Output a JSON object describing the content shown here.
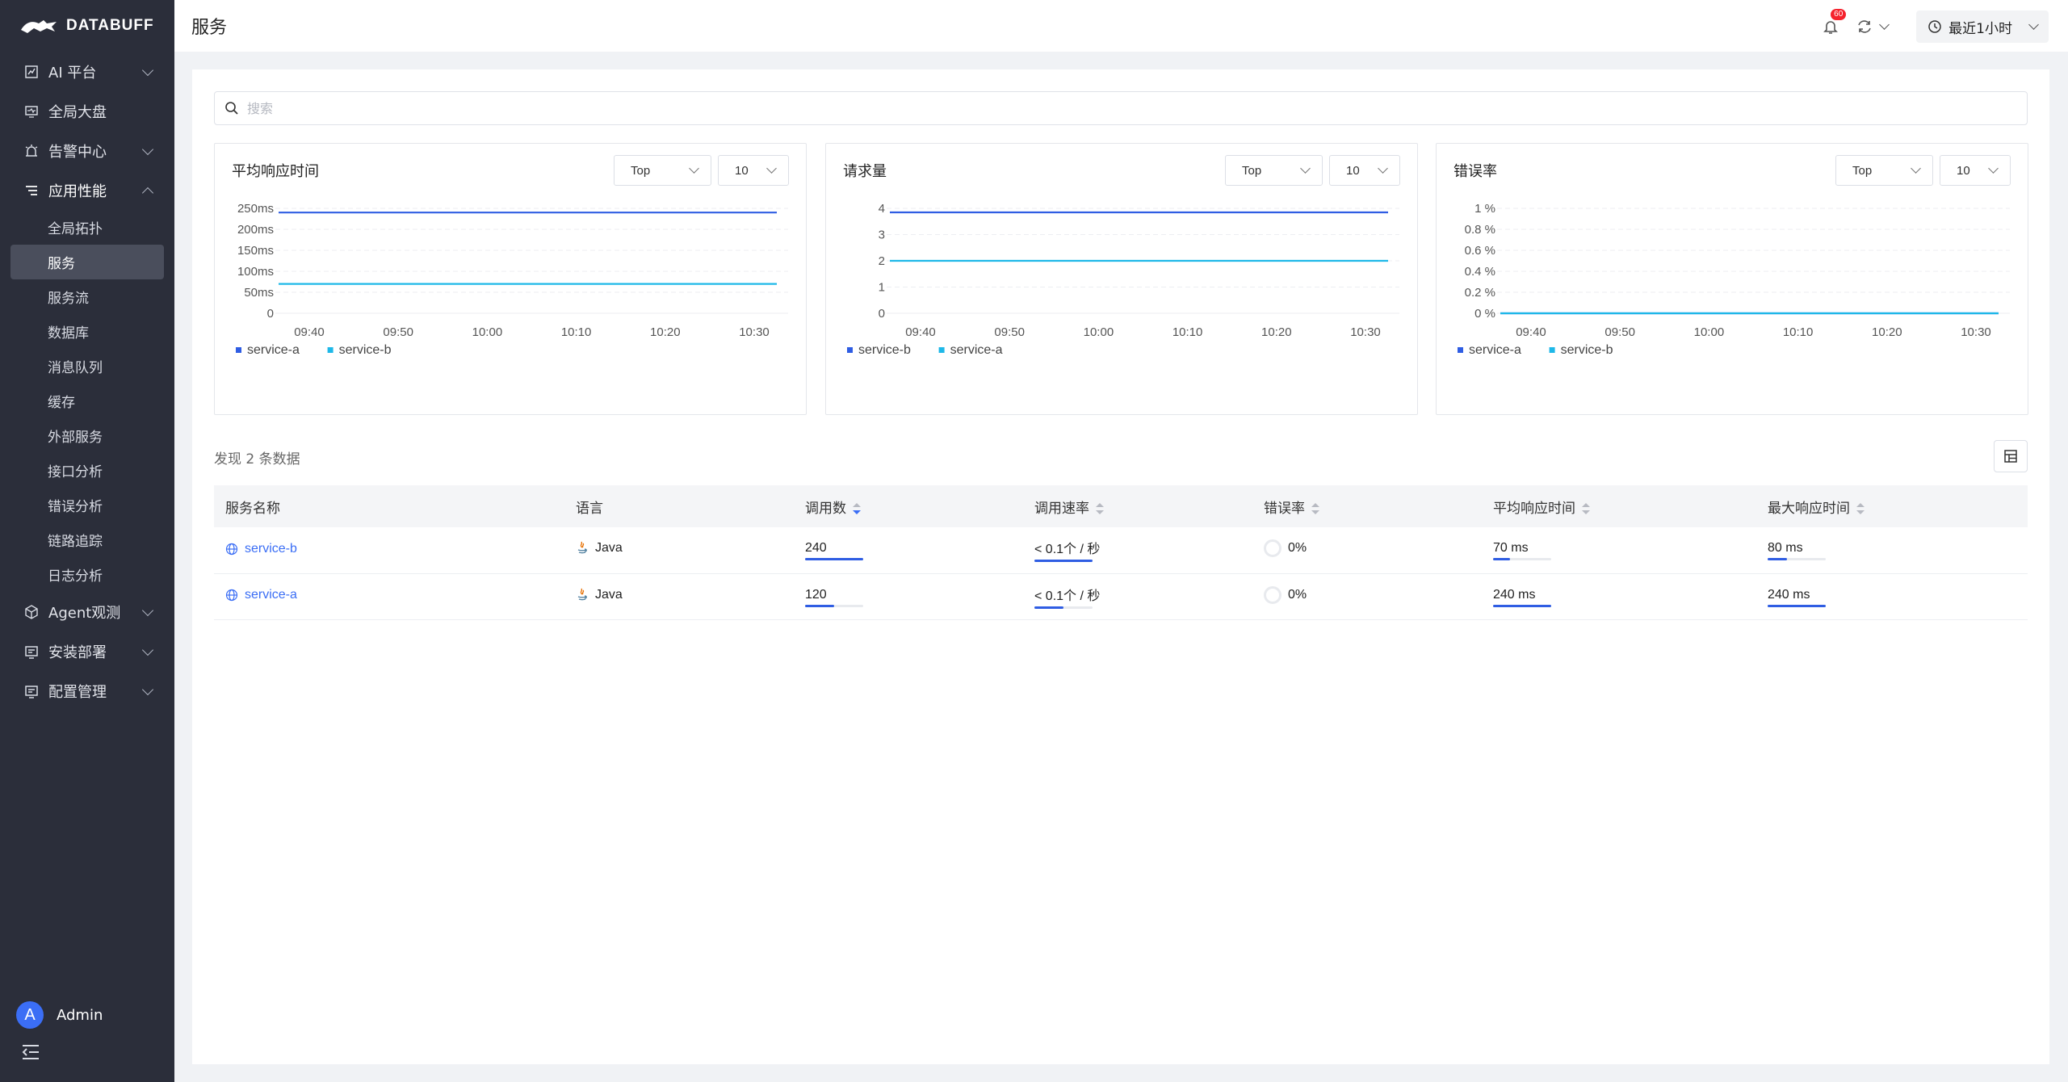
{
  "app": {
    "name": "DATABUFF"
  },
  "sidebar": {
    "items": [
      {
        "label": "AI 平台",
        "icon": "chart-icon",
        "expandable": true
      },
      {
        "label": "全局大盘",
        "icon": "monitor-icon",
        "expandable": false
      },
      {
        "label": "告警中心",
        "icon": "alarm-icon",
        "expandable": true
      },
      {
        "label": "应用性能",
        "icon": "filter-icon",
        "expandable": true,
        "expanded": true
      }
    ],
    "sub_items": [
      "全局拓扑",
      "服务",
      "服务流",
      "数据库",
      "消息队列",
      "缓存",
      "外部服务",
      "接口分析",
      "错误分析",
      "链路追踪",
      "日志分析"
    ],
    "active_sub": "服务",
    "bottom_items": [
      {
        "label": "Agent观测",
        "icon": "cube-icon"
      },
      {
        "label": "安装部署",
        "icon": "install-icon"
      },
      {
        "label": "配置管理",
        "icon": "config-icon"
      }
    ],
    "user": {
      "initial": "A",
      "name": "Admin"
    }
  },
  "header": {
    "title": "服务",
    "notification_count": "60",
    "time_range": "最近1小时"
  },
  "search": {
    "placeholder": "搜索"
  },
  "charts_ui": [
    {
      "title": "平均响应时间",
      "mode": "Top",
      "count": "10"
    },
    {
      "title": "请求量",
      "mode": "Top",
      "count": "10"
    },
    {
      "title": "错误率",
      "mode": "Top",
      "count": "10"
    }
  ],
  "chart_data": [
    {
      "type": "line",
      "title": "平均响应时间",
      "x": [
        "09:40",
        "09:50",
        "10:00",
        "10:10",
        "10:20",
        "10:30"
      ],
      "y_ticks": [
        "0",
        "50ms",
        "100ms",
        "150ms",
        "200ms",
        "250ms"
      ],
      "ylim": [
        0,
        250
      ],
      "series": [
        {
          "name": "service-a",
          "color": "#2f5de3",
          "value": 240
        },
        {
          "name": "service-b",
          "color": "#1eb8e8",
          "value": 70
        }
      ]
    },
    {
      "type": "line",
      "title": "请求量",
      "x": [
        "09:40",
        "09:50",
        "10:00",
        "10:10",
        "10:20",
        "10:30"
      ],
      "y_ticks": [
        "0",
        "1",
        "2",
        "3",
        "4"
      ],
      "ylim": [
        0,
        4
      ],
      "series": [
        {
          "name": "service-b",
          "color": "#2f5de3",
          "value": 4
        },
        {
          "name": "service-a",
          "color": "#1eb8e8",
          "value": 2
        }
      ]
    },
    {
      "type": "line",
      "title": "错误率",
      "x": [
        "09:40",
        "09:50",
        "10:00",
        "10:10",
        "10:20",
        "10:30"
      ],
      "y_ticks": [
        "0 %",
        "0.2 %",
        "0.4 %",
        "0.6 %",
        "0.8 %",
        "1 %"
      ],
      "ylim": [
        0,
        1
      ],
      "series": [
        {
          "name": "service-a",
          "color": "#2f5de3",
          "value": 0
        },
        {
          "name": "service-b",
          "color": "#1eb8e8",
          "value": 0
        }
      ]
    }
  ],
  "table": {
    "found_text": "发现 2 条数据",
    "columns": [
      "服务名称",
      "语言",
      "调用数",
      "调用速率",
      "错误率",
      "平均响应时间",
      "最大响应时间"
    ],
    "rows": [
      {
        "name": "service-b",
        "lang": "Java",
        "calls": "240",
        "calls_ratio": 1.0,
        "rate": "< 0.1个 / 秒",
        "rate_ratio": 1.0,
        "error": "0%",
        "avg": "70 ms",
        "avg_ratio": 0.29,
        "max": "80 ms",
        "max_ratio": 0.33
      },
      {
        "name": "service-a",
        "lang": "Java",
        "calls": "120",
        "calls_ratio": 0.5,
        "rate": "< 0.1个 / 秒",
        "rate_ratio": 0.5,
        "error": "0%",
        "avg": "240 ms",
        "avg_ratio": 1.0,
        "max": "240 ms",
        "max_ratio": 1.0
      }
    ]
  }
}
